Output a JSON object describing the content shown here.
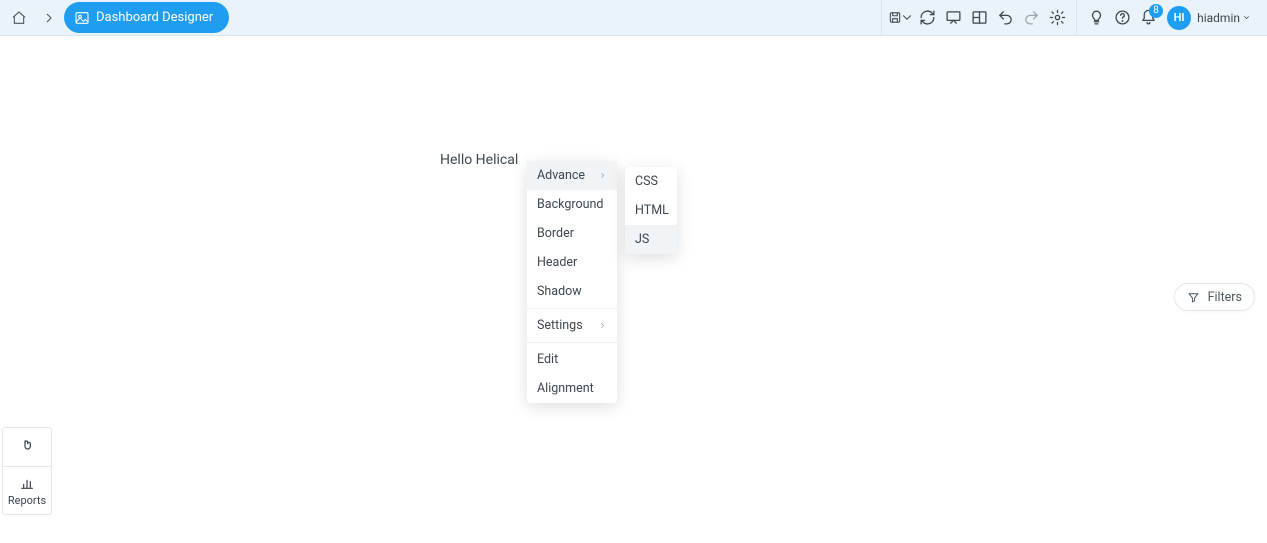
{
  "breadcrumb": {
    "active_label": "Dashboard Designer"
  },
  "canvas": {
    "text": "Hello Helical"
  },
  "context_menu": {
    "items": [
      {
        "label": "Advance",
        "has_sub": true
      },
      {
        "label": "Background"
      },
      {
        "label": "Border"
      },
      {
        "label": "Header"
      },
      {
        "label": "Shadow"
      }
    ],
    "group2": [
      {
        "label": "Settings",
        "has_sub": true
      }
    ],
    "group3": [
      {
        "label": "Edit"
      },
      {
        "label": "Alignment"
      }
    ],
    "submenu": [
      {
        "label": "CSS"
      },
      {
        "label": "HTML"
      },
      {
        "label": "JS",
        "selected": true
      }
    ]
  },
  "notifications": {
    "count": "8"
  },
  "user": {
    "initials": "HI",
    "name": "hiadmin"
  },
  "filters": {
    "label": "Filters"
  },
  "panel": {
    "reports_label": "Reports"
  }
}
